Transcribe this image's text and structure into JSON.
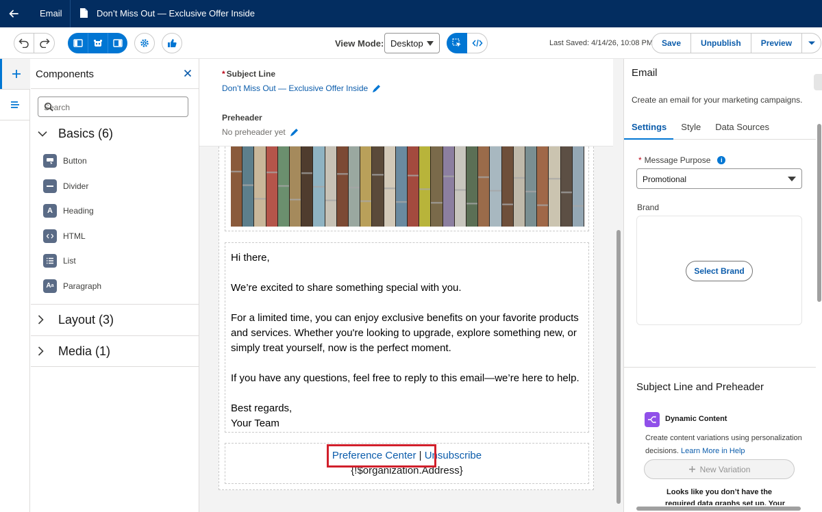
{
  "topbar": {
    "app_label": "Email",
    "doc_title": "Don’t Miss Out — Exclusive Offer Inside"
  },
  "toolbar": {
    "view_mode_label": "View Mode:",
    "view_mode_value": "Desktop",
    "last_saved": "Last Saved: 4/14/26, 10:08 PM",
    "save_label": "Save",
    "unpublish_label": "Unpublish",
    "preview_label": "Preview"
  },
  "components": {
    "title": "Components",
    "search_placeholder": "Search",
    "basics_label": "Basics (6)",
    "basics_items": [
      {
        "label": "Button",
        "icon": "button-icon"
      },
      {
        "label": "Divider",
        "icon": "divider-icon"
      },
      {
        "label": "Heading",
        "icon": "heading-icon"
      },
      {
        "label": "HTML",
        "icon": "html-icon"
      },
      {
        "label": "List",
        "icon": "list-icon"
      },
      {
        "label": "Paragraph",
        "icon": "paragraph-icon"
      }
    ],
    "layout_label": "Layout (3)",
    "media_label": "Media (1)"
  },
  "canvas": {
    "subject_label": "Subject Line",
    "subject_value": "Don’t Miss Out — Exclusive Offer Inside",
    "preheader_label": "Preheader",
    "preheader_value": "No preheader yet",
    "body": {
      "greeting": "Hi there,",
      "p1": "We’re excited to share something special with you.",
      "p2": "For a limited time, you can enjoy exclusive benefits on your favorite products and services. Whether you're looking to upgrade, explore something new, or simply treat yourself, now is the perfect moment.",
      "p3": "If you have any questions, feel free to reply to this email—we’re here to help.",
      "signoff1": "Best regards,",
      "signoff2": "Your Team"
    },
    "footer": {
      "preference_center": "Preference Center",
      "separator": "|",
      "unsubscribe": "Unsubscribe",
      "address": "{!$organization.Address}"
    }
  },
  "right_panel": {
    "title": "Email",
    "description": "Create an email for your marketing campaigns.",
    "tabs": [
      "Settings",
      "Style",
      "Data Sources"
    ],
    "message_purpose_label": "Message Purpose",
    "message_purpose_value": "Promotional",
    "brand_label": "Brand",
    "select_brand_label": "Select Brand",
    "slp_title": "Subject Line and Preheader",
    "dynamic_content_title": "Dynamic Content",
    "dynamic_content_desc": "Create content variations using personalization decisions.",
    "learn_more": "Learn More in Help",
    "new_variation": "New Variation",
    "warning_line1": "Looks like you don’t have the",
    "warning_line2": "required data graphs set up. Your"
  },
  "colors": {
    "header_bg": "#032d60",
    "brand_blue": "#0176d3",
    "link_blue": "#0b5cab",
    "highlight_red": "#d11f2b",
    "dynamic_purple": "#9050e9"
  }
}
